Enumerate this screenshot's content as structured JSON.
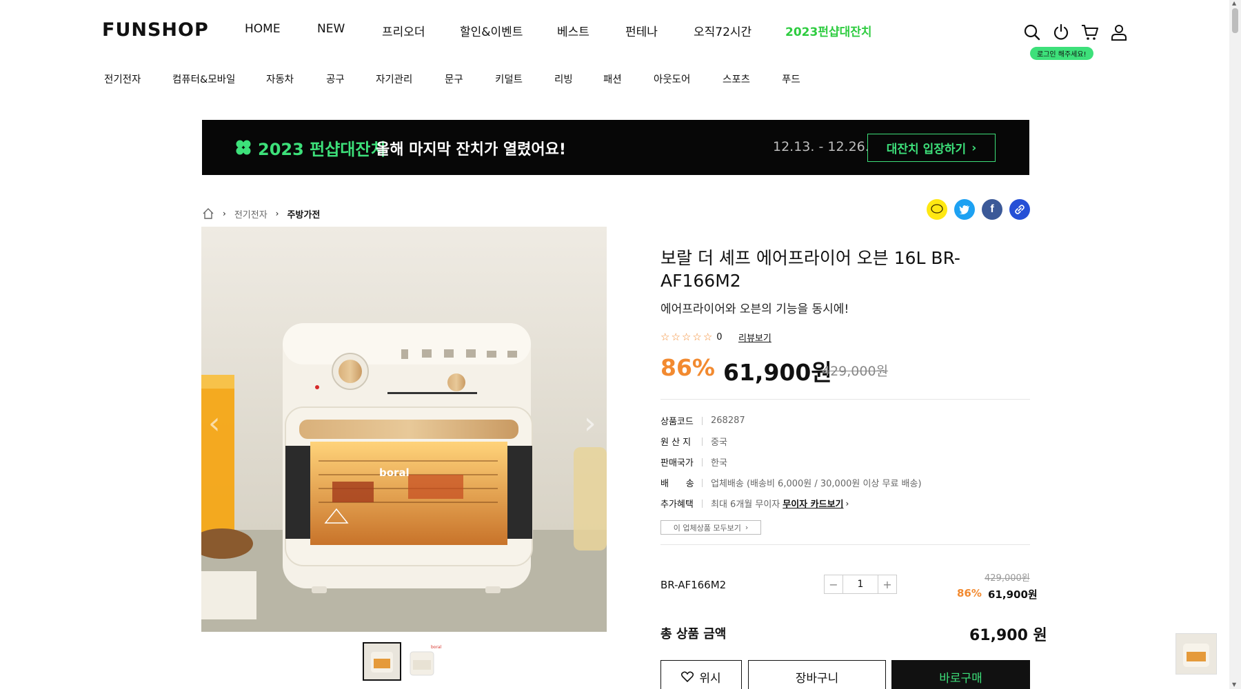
{
  "header": {
    "logo": "FUNSHOP",
    "nav": [
      {
        "label": "HOME"
      },
      {
        "label": "NEW"
      },
      {
        "label": "프리오더"
      },
      {
        "label": "할인&이벤트"
      },
      {
        "label": "베스트"
      },
      {
        "label": "펀테나"
      },
      {
        "label": "오직72시간"
      },
      {
        "label": "2023펀샵대잔치"
      }
    ],
    "login_tooltip": "로그인 해주세요!",
    "icons": [
      "search-icon",
      "power-icon",
      "cart-icon",
      "user-icon"
    ]
  },
  "categories": [
    "전기전자",
    "컴퓨터&모바일",
    "자동차",
    "공구",
    "자기관리",
    "문구",
    "키덜트",
    "리빙",
    "패션",
    "아웃도어",
    "스포츠",
    "푸드"
  ],
  "banner": {
    "title": "2023 펀샵대잔치",
    "subtitle": "올해 마지막 잔치가 열렸어요!",
    "date": "12.13. - 12.26.",
    "button": "대잔치 입장하기",
    "accent": "#3de07a"
  },
  "breadcrumb": {
    "level1": "전기전자",
    "level2": "주방가전"
  },
  "product": {
    "name": "보랄 더 셰프 에어프라이어 오븐 16L BR-AF166M2",
    "description": "에어프라이어와 오븐의 기능을 동시에!",
    "rating_count": "0",
    "review_link": "리뷰보기",
    "discount": "86%",
    "price": "61,900원",
    "original_price": "429,000원",
    "specs": [
      {
        "key": "상품코드",
        "value": "268287"
      },
      {
        "key": "원 산 지",
        "value": "중국"
      },
      {
        "key": "판매국가",
        "value": "한국"
      },
      {
        "key": "배      송",
        "value": "업체배송 (배송비 6,000원 / 30,000원 이상 무료 배송)"
      },
      {
        "key": "추가혜택",
        "value": "최대 6개월 무이자",
        "link": "무이자 카드보기"
      }
    ],
    "vendor_button": "이 업체상품 모두보기",
    "image_brand": "boral"
  },
  "option": {
    "name": "BR-AF166M2",
    "quantity": "1",
    "original_price": "429,000원",
    "discount": "86%",
    "price": "61,900원"
  },
  "total": {
    "label": "총 상품 금액",
    "value": "61,900 원"
  },
  "actions": {
    "wish": "위시",
    "cart": "장바구니",
    "buy": "바로구매"
  },
  "colors": {
    "accent_green": "#3de07a",
    "discount_orange": "#f28a30"
  }
}
